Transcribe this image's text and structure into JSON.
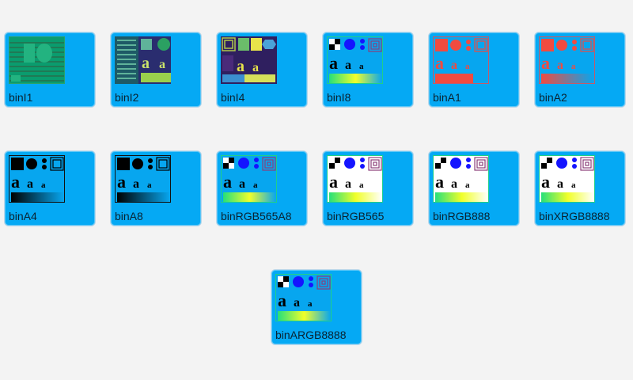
{
  "tiles": [
    {
      "label": "binI1",
      "icon": "image-1bit-indexed-thumbnail"
    },
    {
      "label": "binI2",
      "icon": "image-2bit-indexed-thumbnail"
    },
    {
      "label": "binI4",
      "icon": "image-4bit-indexed-thumbnail"
    },
    {
      "label": "binI8",
      "icon": "image-8bit-indexed-thumbnail"
    },
    {
      "label": "binA1",
      "icon": "image-1bit-alpha-thumbnail"
    },
    {
      "label": "binA2",
      "icon": "image-2bit-alpha-thumbnail"
    },
    {
      "label": "binA4",
      "icon": "image-4bit-alpha-thumbnail"
    },
    {
      "label": "binA8",
      "icon": "image-8bit-alpha-thumbnail"
    },
    {
      "label": "binRGB565A8",
      "icon": "image-rgb565a8-thumbnail"
    },
    {
      "label": "binRGB565",
      "icon": "image-rgb565-thumbnail"
    },
    {
      "label": "binRGB888",
      "icon": "image-rgb888-thumbnail"
    },
    {
      "label": "binXRGB8888",
      "icon": "image-xrgb8888-thumbnail"
    },
    {
      "label": "binARGB8888",
      "icon": "image-argb8888-thumbnail"
    }
  ],
  "colors": {
    "background": "#f3f3f3",
    "tile": "#05a9f4",
    "indexed_green": "#1f8a5e",
    "alpha_red": "#f04b40",
    "thumb_blue": "#1414ff",
    "thumb_purple": "#8b3f7a"
  }
}
